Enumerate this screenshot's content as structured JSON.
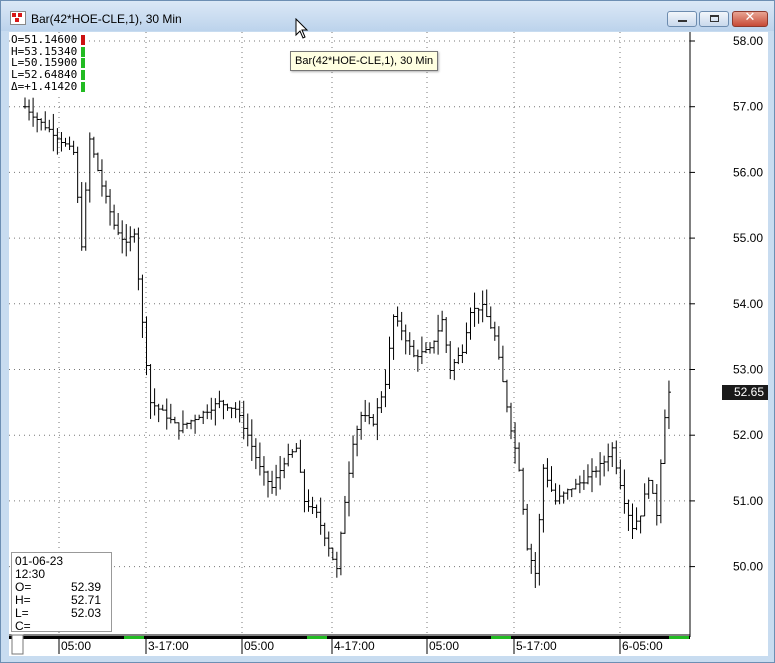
{
  "window": {
    "title": "Bar(42*HOE-CLE,1), 30 Min"
  },
  "tooltip": {
    "text": "Bar(42*HOE-CLE,1), 30 Min"
  },
  "ohlc_header": {
    "rows": [
      {
        "text": "O=51.14600",
        "flag": "#cc1111"
      },
      {
        "text": "H=53.15340",
        "flag": "#22bb22"
      },
      {
        "text": "L=50.15900",
        "flag": "#22bb22"
      },
      {
        "text": "L=52.64840",
        "flag": "#22bb22"
      },
      {
        "text": "Δ=+1.41420",
        "flag": "#22bb22"
      }
    ]
  },
  "info_box": {
    "date": "01-06-23",
    "time": "12:30",
    "rows": [
      {
        "label": "O=",
        "value": "52.39"
      },
      {
        "label": "H=",
        "value": "52.71"
      },
      {
        "label": "L=",
        "value": "52.03"
      },
      {
        "label": "C=",
        "value": ""
      }
    ]
  },
  "last_price": "52.65",
  "chart_data": {
    "type": "bar",
    "title": "Bar(42*HOE-CLE,1), 30 Min",
    "ylim": [
      49.4,
      58.2
    ],
    "y_ticks": [
      "58.00",
      "57.00",
      "56.00",
      "55.00",
      "54.00",
      "53.00",
      "52.00",
      "51.00",
      "50.00"
    ],
    "x_ticks": [
      "05:00",
      "3-17:00",
      "05:00",
      "4-17:00",
      "05:00",
      "5-17:00",
      "6-05:00"
    ],
    "last_price": 52.65,
    "grid": true,
    "bars_count": 160,
    "close_path": [
      [
        0,
        57.0
      ],
      [
        4,
        56.75
      ],
      [
        7,
        56.6
      ],
      [
        12,
        56.3
      ],
      [
        14,
        54.9
      ],
      [
        16,
        56.5
      ],
      [
        19,
        55.8
      ],
      [
        22,
        55.2
      ],
      [
        25,
        54.9
      ],
      [
        27,
        55.1
      ],
      [
        29,
        53.7
      ],
      [
        31,
        52.5
      ],
      [
        34,
        52.35
      ],
      [
        38,
        52.1
      ],
      [
        43,
        52.3
      ],
      [
        48,
        52.5
      ],
      [
        52,
        52.4
      ],
      [
        55,
        52.0
      ],
      [
        58,
        51.5
      ],
      [
        61,
        51.2
      ],
      [
        64,
        51.6
      ],
      [
        67,
        51.8
      ],
      [
        69,
        51.0
      ],
      [
        72,
        50.8
      ],
      [
        75,
        50.3
      ],
      [
        77,
        49.95
      ],
      [
        79,
        51.0
      ],
      [
        81,
        51.9
      ],
      [
        83,
        52.3
      ],
      [
        86,
        52.2
      ],
      [
        89,
        52.8
      ],
      [
        91,
        53.8
      ],
      [
        93,
        53.6
      ],
      [
        96,
        53.2
      ],
      [
        100,
        53.3
      ],
      [
        103,
        53.75
      ],
      [
        105,
        53.0
      ],
      [
        108,
        53.3
      ],
      [
        110,
        53.9
      ],
      [
        113,
        53.95
      ],
      [
        116,
        53.5
      ],
      [
        118,
        52.8
      ],
      [
        120,
        52.1
      ],
      [
        122,
        51.5
      ],
      [
        124,
        50.3
      ],
      [
        126,
        49.9
      ],
      [
        128,
        51.5
      ],
      [
        131,
        51.0
      ],
      [
        135,
        51.2
      ],
      [
        139,
        51.35
      ],
      [
        143,
        51.6
      ],
      [
        145,
        51.8
      ],
      [
        148,
        51.0
      ],
      [
        150,
        50.6
      ],
      [
        152,
        50.8
      ],
      [
        154,
        51.35
      ],
      [
        156,
        50.8
      ],
      [
        157,
        51.6
      ],
      [
        158,
        52.3
      ],
      [
        159,
        52.65
      ]
    ]
  }
}
